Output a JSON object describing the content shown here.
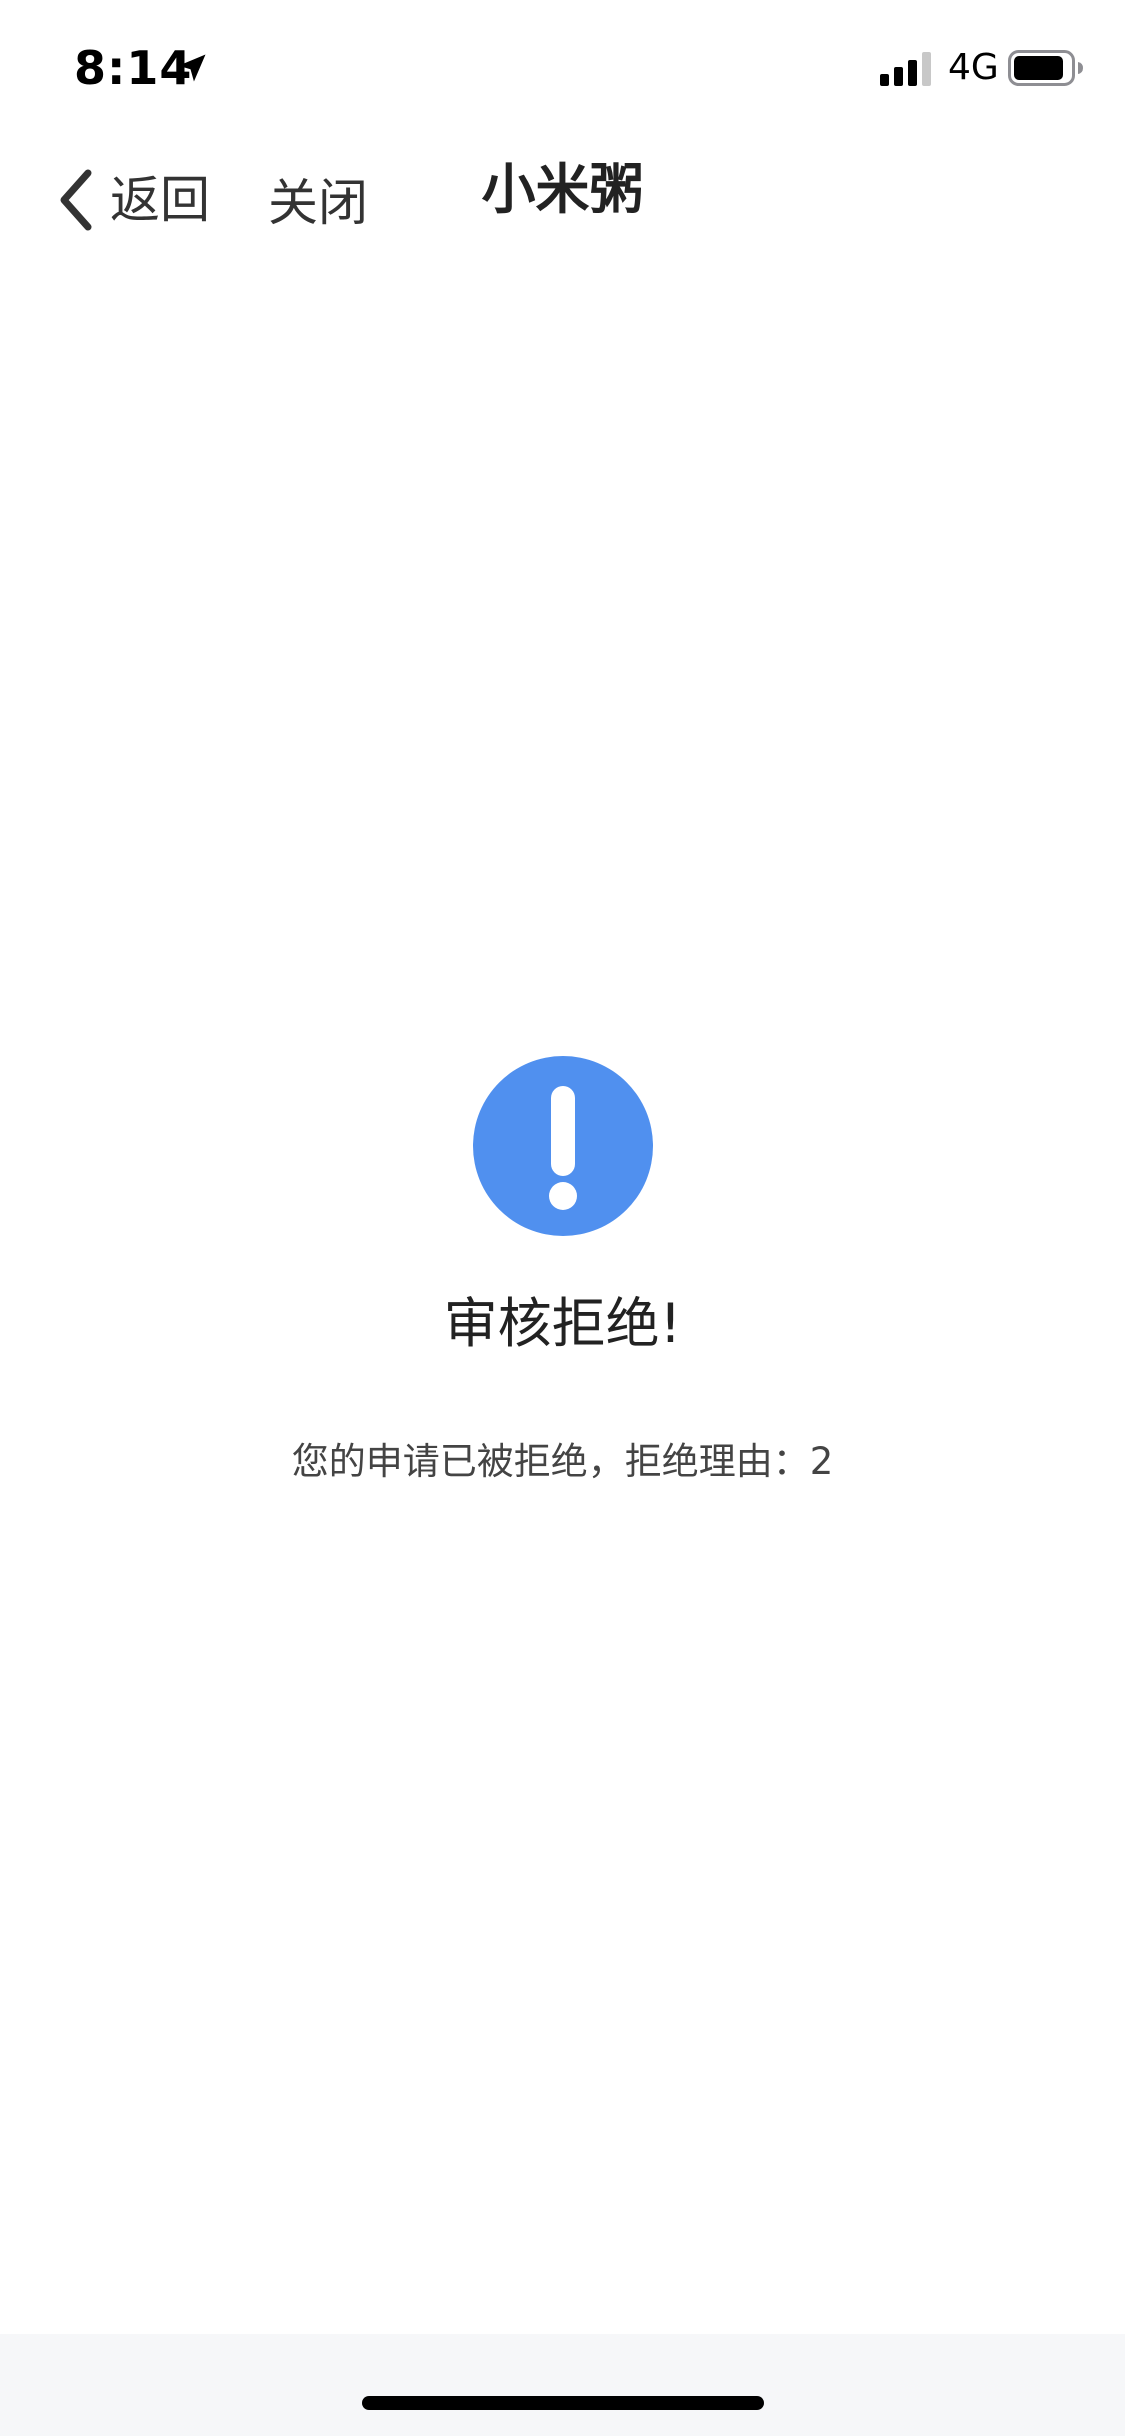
{
  "status_bar": {
    "time": "8:14",
    "location_icon": "location-arrow-icon",
    "signal_icon": "cellular-signal-icon",
    "network": "4G",
    "battery_icon": "battery-icon"
  },
  "nav": {
    "back_icon": "chevron-left-icon",
    "back_label": "返回",
    "close_label": "关闭",
    "title": "小米粥"
  },
  "result": {
    "icon": "exclamation-circle-icon",
    "icon_color": "#5090ef",
    "title": "审核拒绝!",
    "message": "您的申请已被拒绝，拒绝理由：2"
  },
  "colors": {
    "background": "#ffffff",
    "bottom_bar": "#f6f7f9",
    "accent": "#5090ef"
  }
}
